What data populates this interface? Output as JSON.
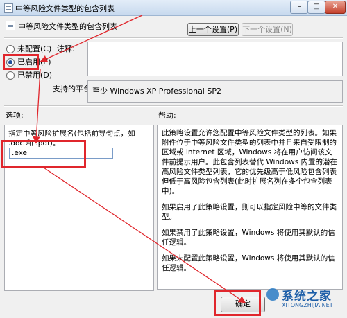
{
  "window": {
    "title": "中等风险文件类型的包含列表",
    "controls": {
      "minimize": "–",
      "maximize": "□",
      "close": "✕"
    }
  },
  "header": {
    "policy_title": "中等风险文件类型的包含列表",
    "prev_button": "上一个设置(P)",
    "next_button": "下一个设置(N)"
  },
  "state_options": [
    {
      "label": "未配置(C)",
      "checked": false
    },
    {
      "label": "已启用(E)",
      "checked": true
    },
    {
      "label": "已禁用(D)",
      "checked": false
    }
  ],
  "comment": {
    "label": "注释:",
    "value": ""
  },
  "platform": {
    "label": "支持的平台:",
    "value": "至少 Windows XP Professional SP2"
  },
  "options": {
    "label": "选项:",
    "description": "指定中等风险扩展名(包括前导句点，如 .doc 和 .pdf)。",
    "input_value": ".exe"
  },
  "help": {
    "label": "帮助:",
    "paragraphs": [
      "此策略设置允许您配置中等风险文件类型的列表。如果附件位于中等风险文件类型的列表中并且来自受限制的区域或 Internet 区域，Windows 将在用户访问该文件前提示用户。此包含列表替代 Windows 内置的潜在高风险文件类型列表，它的优先级高于低风险包含列表但低于高风险包含列表(此时扩展名列在多个包含列表中)。",
      "如果启用了此策略设置，则可以指定风险中等的文件类型。",
      "如果禁用了此策略设置，Windows 将使用其默认的信任逻辑。",
      "如果未配置此策略设置，Windows 将使用其默认的信任逻辑。"
    ]
  },
  "footer": {
    "ok_button": "确定"
  },
  "watermark": {
    "text": "系统之家",
    "url": "XITONGZHIJIA.NET"
  },
  "annotation_color": "#e0262c"
}
